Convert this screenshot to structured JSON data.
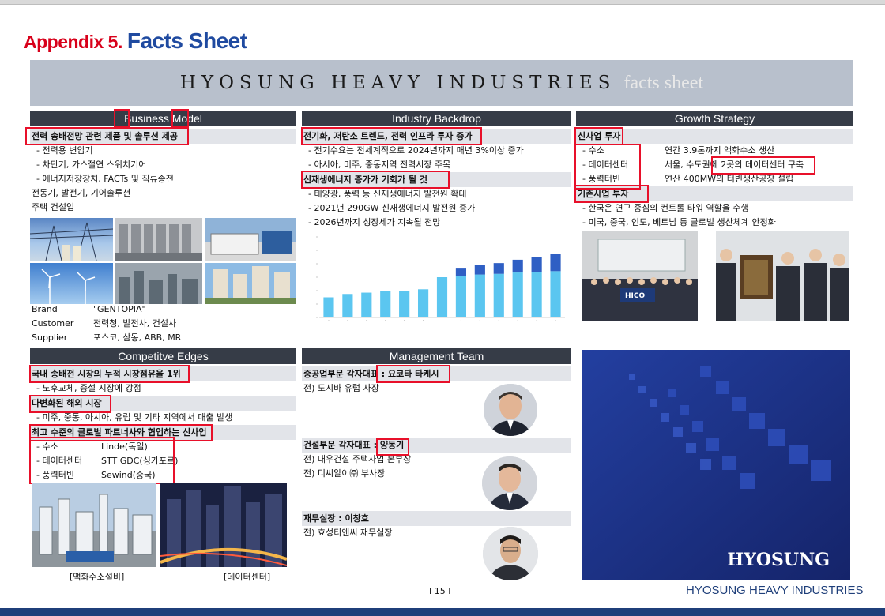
{
  "title": {
    "prefix": "Appendix 5.",
    "main": "Facts Sheet"
  },
  "banner": {
    "company": "HYOSUNG HEAVY INDUSTRIES",
    "subtitle": "facts sheet"
  },
  "business_model": {
    "header": "Business Model",
    "sub1": "전력 송배전망 관련 제품 및 솔루션 제공",
    "items": [
      "- 전력용 변압기",
      "- 차단기, 가스절연 스위치기어",
      "- 에너지저장장치, FACTs 및 직류송전"
    ],
    "line2": "전동기, 발전기, 기어솔루션",
    "line3": "주택 건설업",
    "facts": [
      {
        "k": "Brand",
        "v": "\"GENTOPIA\""
      },
      {
        "k": "Customer",
        "v": "전력청, 발전사, 건설사"
      },
      {
        "k": "Supplier",
        "v": "포스코, 삼동, ABB, MR"
      }
    ]
  },
  "industry": {
    "header": "Industry Backdrop",
    "sub1": "전기화, 저탄소 트렌드, 전력 인프라 투자 증가",
    "items1": [
      "- 전기수요는 전세계적으로 2024년까지 매년 3%이상 증가",
      "- 아시아, 미주, 중동지역 전력시장 주목"
    ],
    "sub2": "신재생에너지 증가가 기회가 될 것",
    "items2": [
      "- 태양광, 풍력 등 신재생에너지 발전원 확대",
      "- 2021년 290GW 신재생에너지 발전원 증가",
      "- 2026년까지 성장세가 지속될 전망"
    ]
  },
  "chart_data": {
    "type": "bar",
    "stacked": true,
    "categories": [
      "",
      "",
      "",
      "",
      "",
      "",
      "",
      "",
      "",
      "",
      "",
      "",
      ""
    ],
    "series": [
      {
        "values": [
          150,
          175,
          185,
          195,
          200,
          210,
          300,
          310,
          320,
          325,
          335,
          340,
          345
        ]
      },
      {
        "values": [
          0,
          0,
          0,
          0,
          0,
          0,
          0,
          60,
          70,
          80,
          95,
          110,
          130
        ]
      }
    ],
    "colors": [
      "#5bc6f0",
      "#2f5fc4"
    ],
    "ylim": [
      0,
      600
    ],
    "grid": false
  },
  "growth": {
    "header": "Growth Strategy",
    "sub1": "신사업 투자",
    "rows": [
      {
        "k": "- 수소",
        "v": "연간 3.9톤까지 액화수소 생산"
      },
      {
        "k": "- 데이터센터",
        "v": "서울, 수도권에 2곳의 데이터센터 구축"
      },
      {
        "k": "- 풍력터빈",
        "v": "연산 400MW의 터빈생산공장 설립"
      }
    ],
    "sub2": "기존사업 투자",
    "items2": [
      "- 한국은 연구 중심의 컨트롤 타워 역할을 수행",
      "- 미국, 중국, 인도, 베트남 등 글로벌 생산체계 안정화"
    ],
    "sign": "HICO"
  },
  "competitive": {
    "header": "Competitve Edges",
    "sub1": "국내 송배전 시장의 누적 시장점유율 1위",
    "item1": "- 노후교체, 증설 시장에 강점",
    "sub2": "다변화된 해외 시장",
    "item2": "- 미주, 중동, 아시아, 유럽 및 기타 지역에서 매출 발생",
    "sub3": "최고 수준의 글로벌 파트너사와 협업하는 신사업",
    "rows": [
      {
        "k": "- 수소",
        "v": "Linde(독일)"
      },
      {
        "k": "- 데이터센터",
        "v": "STT GDC(싱가포르)"
      },
      {
        "k": "- 풍력터빈",
        "v": "Sewind(중국)"
      }
    ],
    "cap1": "[액화수소설비]",
    "cap2": "[데이터센터]"
  },
  "management": {
    "header": "Management Team",
    "p1_title": "중공업부문 각자대표 : 요코타 타케시",
    "p1_note": "전) 도시바 유럽 사장",
    "p2_title": "건설부문 각자대표 : 양동기",
    "p2_note1": "전) 대우건설 주택사업 본부장",
    "p2_note2": "전) 디씨알이㈜ 부사장",
    "p3_title": "재무실장 : 이창호",
    "p3_note": "전) 효성티앤씨 재무실장"
  },
  "brand_panel": {
    "logo": "HYOSUNG"
  },
  "footer": {
    "page": "I 15 I",
    "company": "HYOSUNG HEAVY INDUSTRIES"
  }
}
